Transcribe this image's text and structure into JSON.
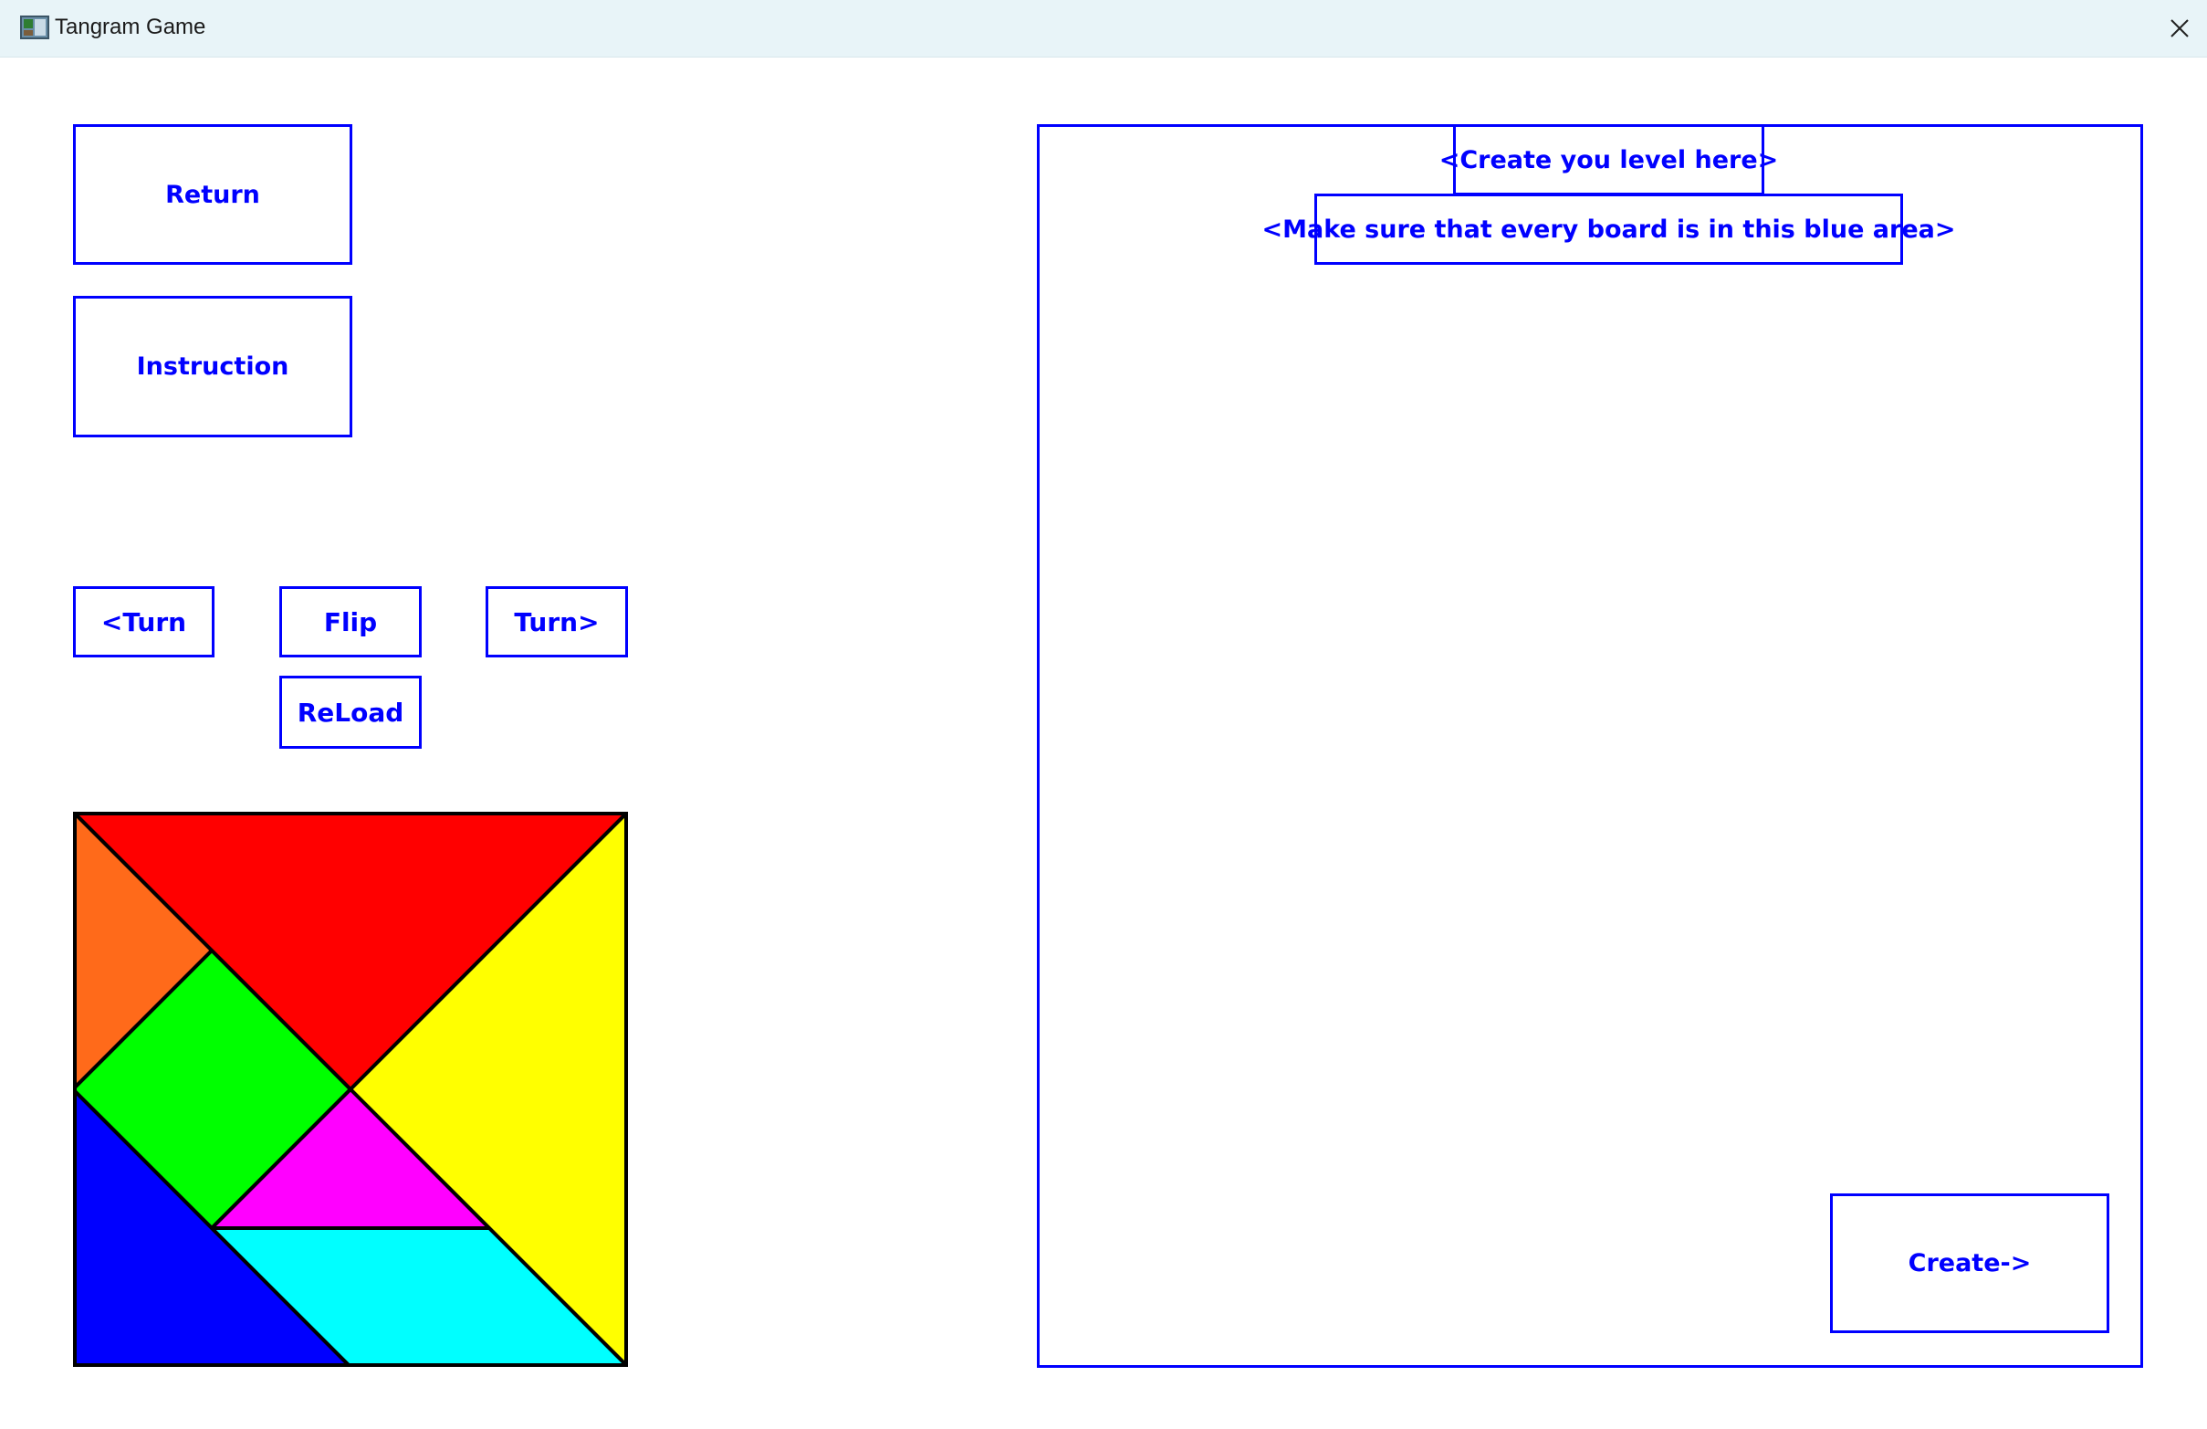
{
  "window": {
    "title": "Tangram Game",
    "app_icon": "app-image-icon",
    "close_icon": "close-x-icon"
  },
  "buttons": {
    "return": "Return",
    "instruction": "Instruction",
    "turn_left": "<Turn",
    "flip": "Flip",
    "turn_right": "Turn>",
    "reload": "ReLoad",
    "create": "Create->"
  },
  "editor": {
    "header_label": "<Create you level here>",
    "hint_label": "<Make sure that every board is in this blue area>"
  },
  "colors": {
    "accent": "#0000ff",
    "piece_large_red": "#ff0000",
    "piece_large_yellow": "#ffff00",
    "piece_small_orange": "#ff6a1a",
    "piece_square_green": "#00ff00",
    "piece_small_magenta": "#ff00ff",
    "piece_medium_blue": "#0000ff",
    "piece_parallelogram_cyan": "#00ffff"
  }
}
